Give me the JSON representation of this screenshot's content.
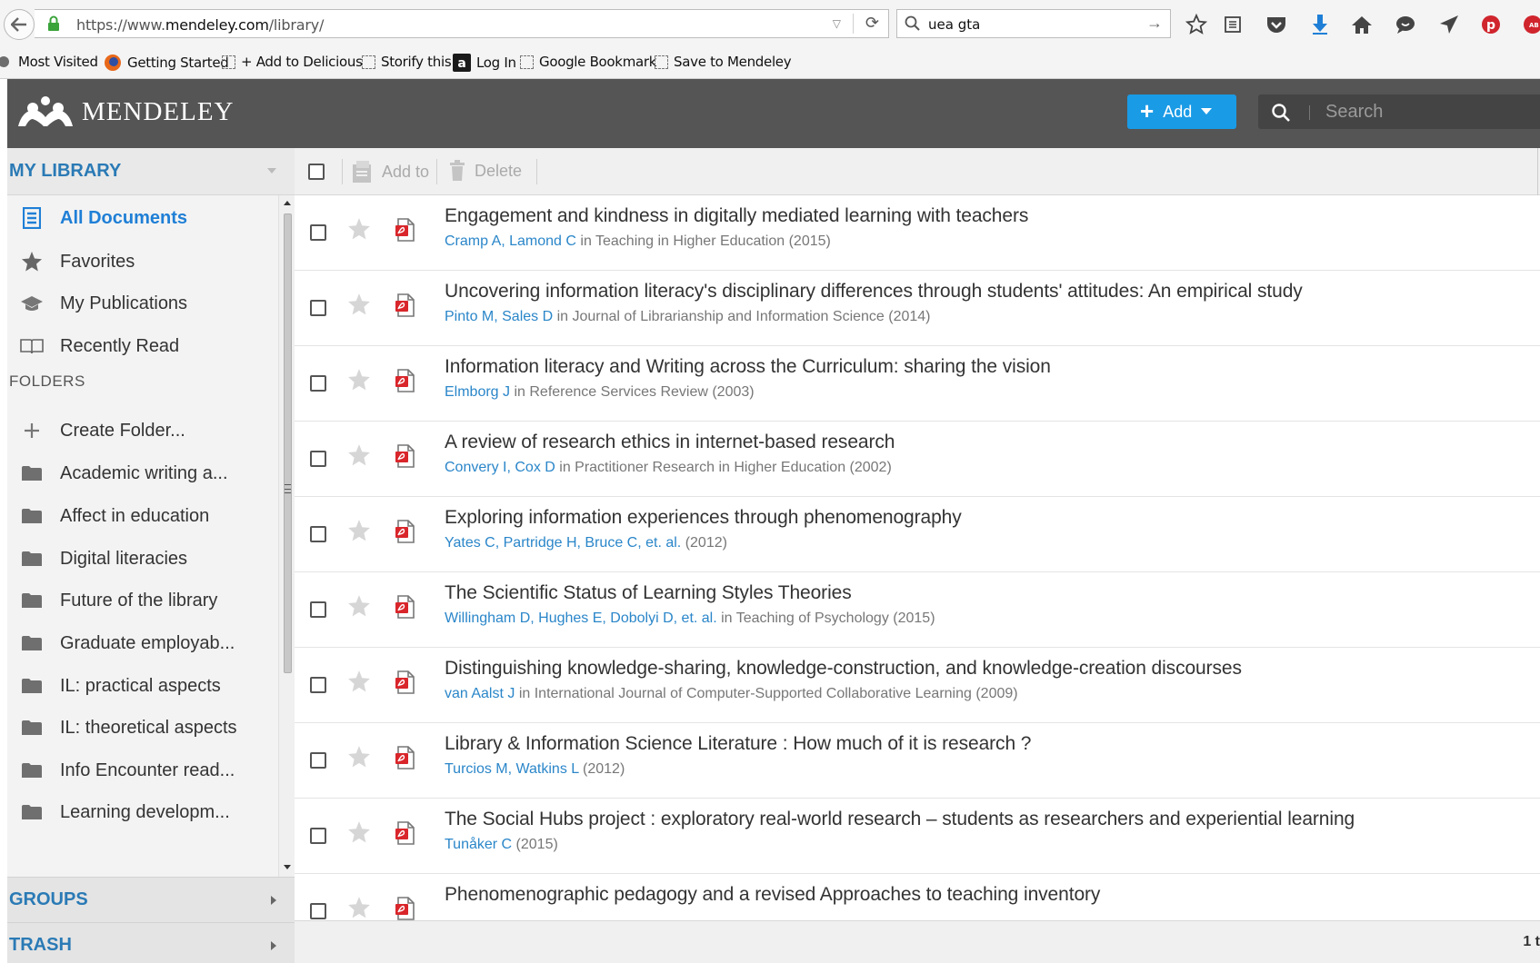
{
  "browser": {
    "url_prefix": "https://www.",
    "url_domain": "mendeley.com",
    "url_path": "/library/",
    "search_query": "uea gta",
    "bookmarks": [
      {
        "label": "Most Visited"
      },
      {
        "label": "Getting Started"
      },
      {
        "label": "+ Add to Delicious"
      },
      {
        "label": "Storify this"
      },
      {
        "label": "Log In"
      },
      {
        "label": "Google Bookmark"
      },
      {
        "label": "Save to Mendeley"
      }
    ]
  },
  "header": {
    "logo_text": "MENDELEY",
    "add_label": "Add",
    "search_placeholder": "Search",
    "brand_color": "#1a9be6"
  },
  "sidebar": {
    "title": "MY LIBRARY",
    "items": [
      {
        "label": "All Documents",
        "icon": "all-documents-icon"
      },
      {
        "label": "Favorites",
        "icon": "star-icon"
      },
      {
        "label": "My Publications",
        "icon": "graduation-cap-icon"
      },
      {
        "label": "Recently Read",
        "icon": "book-icon"
      }
    ],
    "folders_heading": "FOLDERS",
    "create_folder": "Create Folder...",
    "folders": [
      {
        "label": "Academic writing a..."
      },
      {
        "label": "Affect in education"
      },
      {
        "label": "Digital literacies"
      },
      {
        "label": "Future of the library"
      },
      {
        "label": "Graduate employab..."
      },
      {
        "label": "IL: practical aspects"
      },
      {
        "label": "IL: theoretical aspects"
      },
      {
        "label": "Info Encounter read..."
      },
      {
        "label": "Learning developm..."
      }
    ],
    "groups": "GROUPS",
    "trash": "TRASH"
  },
  "toolbar": {
    "add_to": "Add to",
    "delete": "Delete"
  },
  "documents": [
    {
      "title": "Engagement and kindness in digitally mediated learning with teachers",
      "authors": "Cramp A, Lamond C",
      "rest": " in Teaching in Higher Education (2015)"
    },
    {
      "title": "Uncovering information literacy's disciplinary differences through students' attitudes: An empirical study",
      "authors": "Pinto M, Sales D",
      "rest": " in Journal of Librarianship and Information Science (2014)"
    },
    {
      "title": "Information literacy and Writing across the Curriculum: sharing the vision",
      "authors": "Elmborg J",
      "rest": " in Reference Services Review (2003)"
    },
    {
      "title": "A review of research ethics in internet-based research",
      "authors": "Convery I, Cox D",
      "rest": " in Practitioner Research in Higher Education (2002)"
    },
    {
      "title": "Exploring information experiences through phenomenography",
      "authors": "Yates C, Partridge H, Bruce C, et. al.",
      "rest": " (2012)"
    },
    {
      "title": "The Scientific Status of Learning Styles Theories",
      "authors": "Willingham D, Hughes E, Dobolyi D, et. al.",
      "rest": " in Teaching of Psychology (2015)"
    },
    {
      "title": "Distinguishing knowledge-sharing, knowledge-construction, and knowledge-creation discourses",
      "authors": "van Aalst J",
      "rest": " in International Journal of Computer-Supported Collaborative Learning (2009)"
    },
    {
      "title": "Library & Information Science Literature : How much of it is research ?",
      "authors": "Turcios M, Watkins L",
      "rest": " (2012)"
    },
    {
      "title": "The Social Hubs project : exploratory real-world research – students as researchers and experiential learning",
      "authors": "Tunåker C",
      "rest": " (2015)"
    },
    {
      "title": "Phenomenographic pedagogy and a revised Approaches to teaching inventory",
      "authors": "",
      "rest": ""
    }
  ],
  "status": {
    "pagination": "1 t"
  }
}
